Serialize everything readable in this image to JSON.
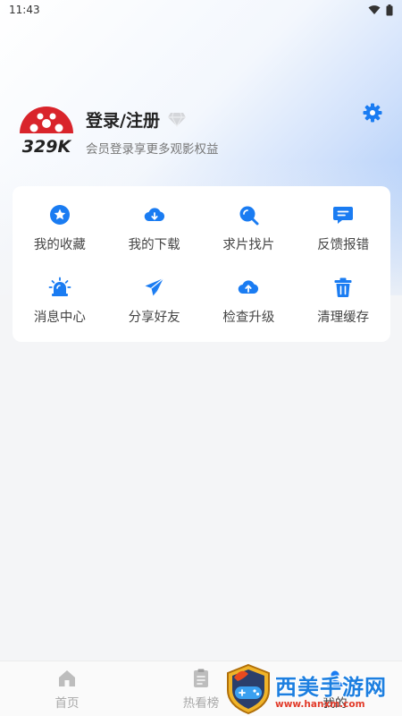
{
  "status_bar": {
    "time": "11:43"
  },
  "profile": {
    "logo_text": "329K",
    "login_label": "登录/注册",
    "subtitle": "会员登录享更多观影权益"
  },
  "menu": {
    "items": [
      {
        "label": "我的收藏",
        "icon": "star-badge-icon"
      },
      {
        "label": "我的下载",
        "icon": "cloud-download-icon"
      },
      {
        "label": "求片找片",
        "icon": "search-icon"
      },
      {
        "label": "反馈报错",
        "icon": "feedback-message-icon"
      },
      {
        "label": "消息中心",
        "icon": "alarm-light-icon"
      },
      {
        "label": "分享好友",
        "icon": "paper-plane-icon"
      },
      {
        "label": "检查升级",
        "icon": "cloud-upload-icon"
      },
      {
        "label": "清理缓存",
        "icon": "trash-icon"
      }
    ]
  },
  "tabbar": {
    "tabs": [
      {
        "label": "首页",
        "icon": "home-icon"
      },
      {
        "label": "热看榜",
        "icon": "clipboard-icon"
      },
      {
        "label": "我的",
        "icon": "user-icon",
        "active": true
      }
    ]
  },
  "watermark": {
    "title": "西美手游网",
    "url": "www.hanxm.com"
  },
  "colors": {
    "accent": "#1a7cf2",
    "logo_red": "#d9242b"
  }
}
